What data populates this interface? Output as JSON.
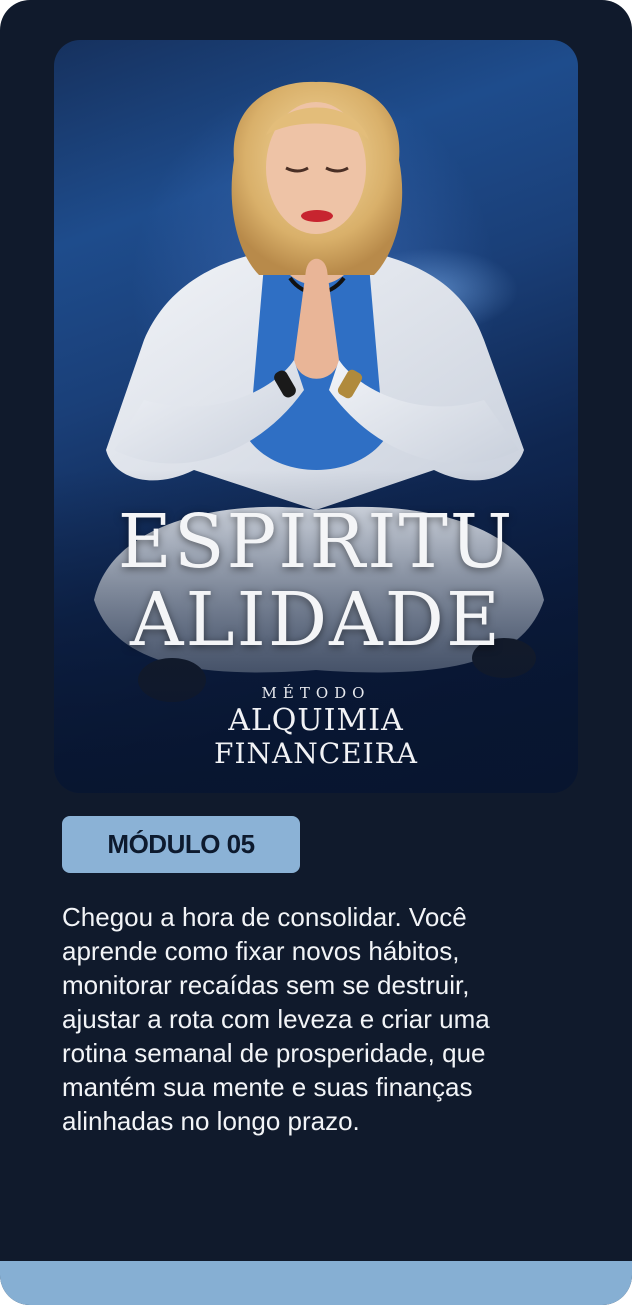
{
  "cover": {
    "title_line1": "ESPIRITU",
    "title_line2": "ALIDADE",
    "metodo": "MÉTODO",
    "brand_line1": "ALQUIMIA",
    "brand_line2": "FINANCEIRA"
  },
  "module": {
    "badge": "MÓDULO 05",
    "description_lines": [
      "Chegou a hora de consolidar. Você",
      "aprende como fixar novos hábitos,",
      "monitorar recaídas sem se destruir,",
      "ajustar a rota com leveza e criar uma",
      "rotina semanal de prosperidade, que",
      "mantém sua mente e suas finanças",
      "alinhadas no longo prazo."
    ]
  },
  "colors": {
    "card_background": "#101a2c",
    "badge_background": "#8bb2d6",
    "bottom_bar": "#86afd3"
  }
}
